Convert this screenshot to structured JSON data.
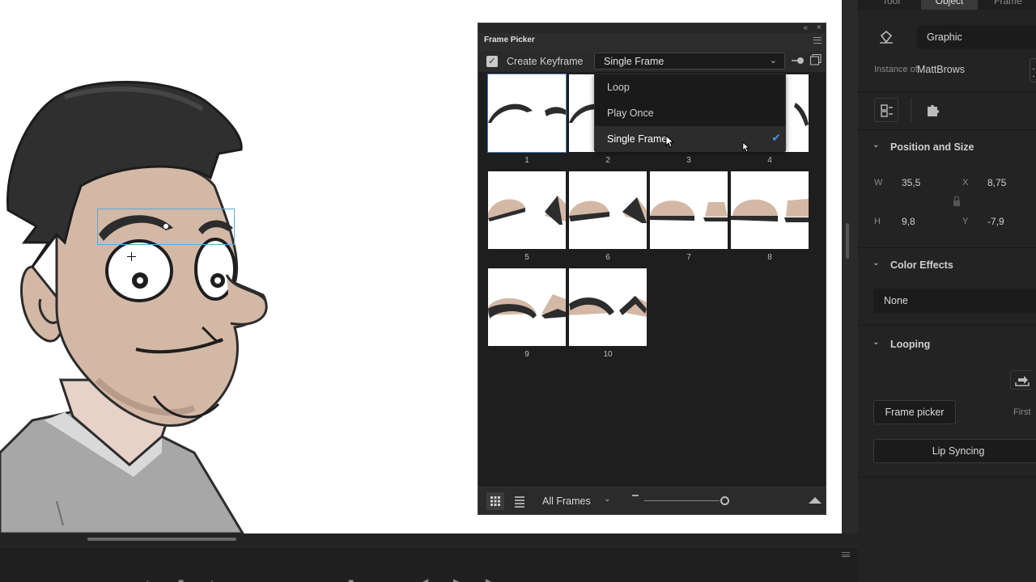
{
  "frame_picker": {
    "title": "Frame Picker",
    "create_keyframe_label": "Create Keyframe",
    "create_keyframe_checked": true,
    "loop_mode_selected": "Single Frame",
    "loop_options": [
      {
        "label": "Loop",
        "selected": false
      },
      {
        "label": "Play Once",
        "selected": false
      },
      {
        "label": "Single Frame",
        "selected": true
      }
    ],
    "frames": [
      {
        "number": "1",
        "selected": true
      },
      {
        "number": "2"
      },
      {
        "number": "3"
      },
      {
        "number": "4"
      },
      {
        "number": "5"
      },
      {
        "number": "6"
      },
      {
        "number": "7"
      },
      {
        "number": "8"
      },
      {
        "number": "9"
      },
      {
        "number": "10"
      }
    ],
    "footer": {
      "filter_label": "All Frames"
    }
  },
  "properties": {
    "tabs": [
      "Tool",
      "Object",
      "Frame"
    ],
    "active_tab": "Object",
    "symbol_type": "Graphic",
    "instance_of_label": "Instance of:",
    "instance_of_value": "MattBrows",
    "position_size": {
      "title": "Position and Size",
      "w_label": "W",
      "w_value": "35,5",
      "x_label": "X",
      "x_value": "8,75",
      "h_label": "H",
      "h_value": "9,8",
      "y_label": "Y",
      "y_value": "-7,9"
    },
    "color_effects": {
      "title": "Color Effects",
      "value": "None"
    },
    "looping": {
      "title": "Looping",
      "frame_picker_button": "Frame picker",
      "first_label": "First"
    },
    "lip_syncing_button": "Lip Syncing"
  },
  "colors": {
    "accent": "#4a90e2",
    "panel_bg": "#222222",
    "stage_bg": "#ffffff",
    "skin": "#d4b8a6",
    "hair": "#2f2f2f"
  }
}
